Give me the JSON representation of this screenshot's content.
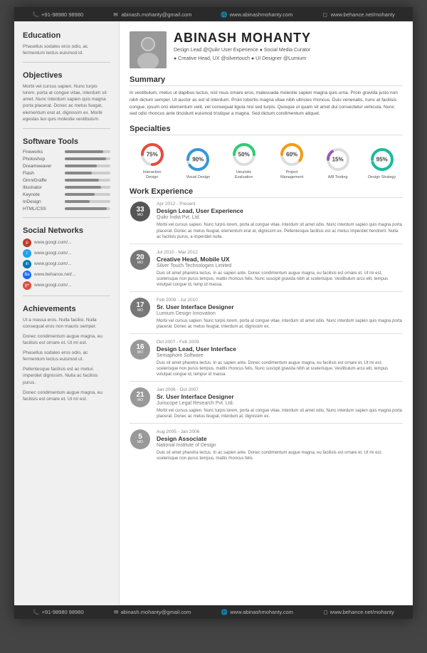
{
  "topbar": {
    "phone": "+91-98980 98980",
    "email": "abinash.mohanty@gmail.com",
    "website": "www.abinashmohanty.com",
    "portfolio": "www.behance.net/mohanty"
  },
  "header": {
    "name": "ABINASH MOHANTY",
    "subtitle1": "Design Lead @Quikr User Experience  ●  Social Media Curator",
    "subtitle2": "● Creative Head, UX @silvertouch  ●  UI Designer @Lumium"
  },
  "sidebar": {
    "education_title": "Education",
    "education_text": "Phasellus sodales eros odio, ac fermentum lectus euismod id.",
    "objectives_title": "Objectives",
    "objectives_text": "Morbi vel cursus sapien. Nunc turpis lorem, porta at congue vitae, interdum sit amet. Nunc interdum sapien quis magna porta placerat. Donec ac metus fuegat, elementum erat at, dignissim ex. Morbi egestas leo quis molestie vestibulum.",
    "softwaretools_title": "Software Tools",
    "tools": [
      {
        "name": "Fireworks",
        "pct": 85
      },
      {
        "name": "Photoshop",
        "pct": 90
      },
      {
        "name": "Dreamweaver",
        "pct": 70
      },
      {
        "name": "Flash",
        "pct": 60
      },
      {
        "name": "OmniGraffe",
        "pct": 75
      },
      {
        "name": "Illustrator",
        "pct": 80
      },
      {
        "name": "Keynote",
        "pct": 65
      },
      {
        "name": "InDesign",
        "pct": 55
      },
      {
        "name": "HTML/CSS",
        "pct": 92
      }
    ],
    "social_title": "Social Networks",
    "social": [
      {
        "icon": "p",
        "color": "#c0392b",
        "text": "www.googl.com/..."
      },
      {
        "icon": "t",
        "color": "#1da1f2",
        "text": "www.googl.com/..."
      },
      {
        "icon": "in",
        "color": "#0077b5",
        "text": "www.googl.com/..."
      },
      {
        "icon": "Be",
        "color": "#1769ff",
        "text": "www.behance.net/..."
      },
      {
        "icon": "g+",
        "color": "#dd4b39",
        "text": "www.googl.com/..."
      }
    ],
    "achievements_title": "Achievements",
    "achievements": [
      "Ut a massa eros. Nulla facilisi. Nulla consequat eros non mauris semper.",
      "Donec condimentum augue magna, eu facilisis est ornare et. Ut mi est.",
      "Phasellus sodales eros odio, ac fermentum lectus euismod ut.",
      "Pellentesque facilisis est ac metus imperdiet dignissim. Nulla ac facilisis purus.",
      "Donec condimentum augue magna, eu facilisis est ornare et. Ut mi est."
    ]
  },
  "summary": {
    "title": "Summary",
    "text": "In vestibulum, metus ut dapibus luctus, nisl nsus ornare eros, malesuada molestie sapien magna quis urna. Proin gravida justo non nibh dictum semper. Ut auctor ac est id interdum. Proin lobortis magna vitae nibh ultricies rhoncus. Duis venenatis, nunc at facilisis congue, ipsum orci elementum velit, vel consequat ligula nisl sed turpis. Quisque ut quam sit amet dui consectetur vehicula. Nunc sed odio rhoncus ante tincidunt euismod tristique a magna. Sed dictum condimentum aliquet."
  },
  "specialties": {
    "title": "Specialties",
    "items": [
      {
        "pct": 75,
        "label": "Interaction Design"
      },
      {
        "pct": 90,
        "label": "Visual Design"
      },
      {
        "pct": 50,
        "label": "Heuristic Evaluation"
      },
      {
        "pct": 60,
        "label": "Project Management"
      },
      {
        "pct": 15,
        "label": "A/B Testing"
      },
      {
        "pct": 95,
        "label": "Design Strategy"
      }
    ]
  },
  "work": {
    "title": "Work Experience",
    "items": [
      {
        "months": "33",
        "date": "Apr 2012 - Present",
        "title": "Design Lead, User Experience",
        "company": "Quikr India Pvt. Ltd.",
        "desc": "Morbi vel cursus sapien. Nunc turpis lorem, porta at congue vitae, interdum sit amet odio. Nunc interdum sapien quis magna porta placerat. Donec ac metus feugiat, elementum erat at, dignissim ex. Pellentesque facilisis est ac metus imperdiet hendrerit. Nulla ac facilisis purus, a imperdiet nulla.",
        "badge_shade": "dark"
      },
      {
        "months": "20",
        "date": "Jul 2010 - Mar 2012",
        "title": "Creative Head, Mobile UX",
        "company": "Silver Touch Technologies Limited",
        "desc": "Duis sit amet pharetra lectus. In ac sapien ante. Donec condimentum augue magna, eu facilisis est ornare et. Ut mi est, scelerisque non purus tempus, mattis rhoncus felis. Nunc suscipit gravida nibh at scelerisque. Vestibulum arcu elit, tempus volutpat congue id, temp id massa.",
        "badge_shade": "med"
      },
      {
        "months": "17",
        "date": "Feb 2009 - Jul 2010",
        "title": "Sr. User Interface Designer",
        "company": "Lumium Design Innovation",
        "desc": "Morbi vel cursus sapien. Nunc turpis lorem, porta at congue vitae, interdum sit amet odio. Nunc interdum sapien quis magna porta placerat. Donec ac metus feugiat, interdum at, dignissim ex.",
        "badge_shade": "med"
      },
      {
        "months": "16",
        "date": "Oct 2007 - Feb 2009",
        "title": "Design Lead, User Interface",
        "company": "Semaphore Software",
        "desc": "Duis sit amet pharetra lectus. In ac sapien ante. Donec condimentum augue magna, eu facilisis est ornare et. Ut mi est, scelerisque non purus tempus, mattis rhoncus felis. Nunc suscipit gravida nibh at scelerisque. Vestibulum arcu elit, tempus volutpat congue id, tempor id massa.",
        "badge_shade": "light"
      },
      {
        "months": "21",
        "date": "Jan 2006 - Oct 2007",
        "title": "Sr. User Interface Designer",
        "company": "Juriscope Legal Research Pvt. Ltd.",
        "desc": "Morbi vel cursus sapien. Nunc turpis lorem, porta at congue vitae, interdum sit amet odio. Nunc interdum sapien quis magna porta placerat. Donec ac metus feugiat, interdum at, dignissim ex.",
        "badge_shade": "light"
      },
      {
        "months": "5",
        "date": "Aug 2005 - Jan 2006",
        "title": "Design Associate",
        "company": "National Institute of Design",
        "desc": "Duis sit amet pharetra lectus. In ac sapien ante. Donec condimentum augue magna, eu facilisis est ornare et. Ut mi est, scelerisque non purus tempus, mattis rhoncus felis.",
        "badge_shade": "light"
      }
    ]
  },
  "bottombar": {
    "phone": "+91-98980 98980",
    "email": "abinash.mohanty@gmail.com",
    "website": "www.abinashmohanty.com",
    "portfolio": "www.behance.net/mohanty"
  }
}
